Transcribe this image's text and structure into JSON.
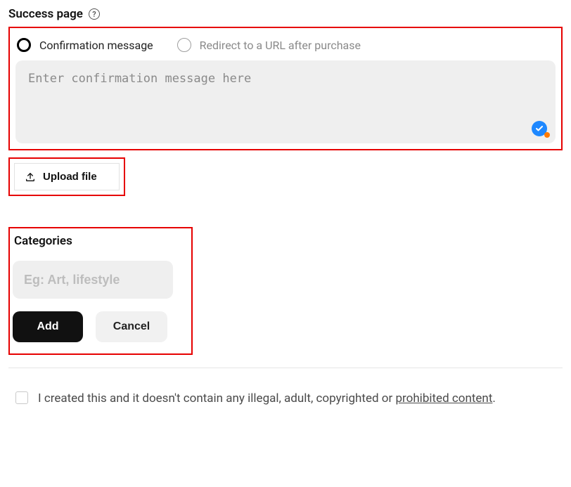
{
  "section_title": "Success page",
  "radios": {
    "confirmation": "Confirmation message",
    "redirect": "Redirect to a URL after purchase"
  },
  "message_placeholder": "Enter confirmation message here",
  "upload_label": "Upload file",
  "categories": {
    "title": "Categories",
    "placeholder": "Eg: Art, lifestyle",
    "add_label": "Add",
    "cancel_label": "Cancel"
  },
  "consent": {
    "text_prefix": "I created this and it doesn't contain any illegal, adult, copyrighted or ",
    "link_label": "prohibited content",
    "text_suffix": "."
  }
}
